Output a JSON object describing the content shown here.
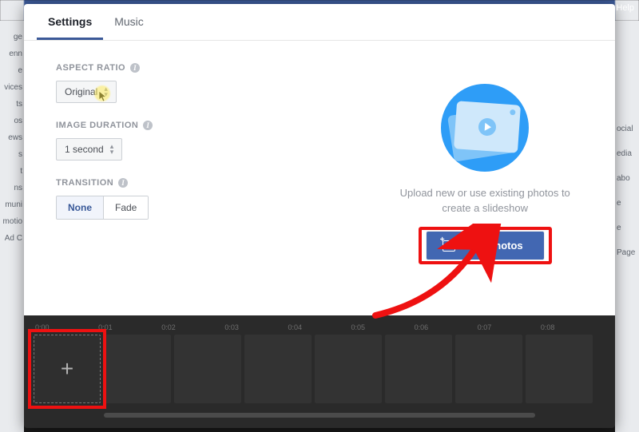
{
  "bg": {
    "help": "Help",
    "left_items": [
      "ge",
      "enn",
      "e",
      "vices",
      "ts",
      "os",
      "ews",
      "s",
      "t",
      "ns",
      "muni",
      "motio",
      "Ad C"
    ],
    "right_items": [
      "ocial",
      "edia",
      "abo",
      "e",
      "e",
      "Page"
    ]
  },
  "tabs": {
    "settings": "Settings",
    "music": "Music"
  },
  "settings": {
    "aspect_ratio": {
      "label": "ASPECT RATIO",
      "value": "Original"
    },
    "image_duration": {
      "label": "IMAGE DURATION",
      "value": "1 second"
    },
    "transition": {
      "label": "TRANSITION",
      "option_none": "None",
      "option_fade": "Fade"
    }
  },
  "preview": {
    "hint": "Upload new or use existing photos to create a slideshow",
    "add_photos": "Add Photos"
  },
  "timeline": {
    "ticks": [
      "0:00",
      "0:01",
      "0:02",
      "0:03",
      "0:04",
      "0:05",
      "0:06",
      "0:07",
      "0:08"
    ],
    "add_glyph": "+"
  }
}
